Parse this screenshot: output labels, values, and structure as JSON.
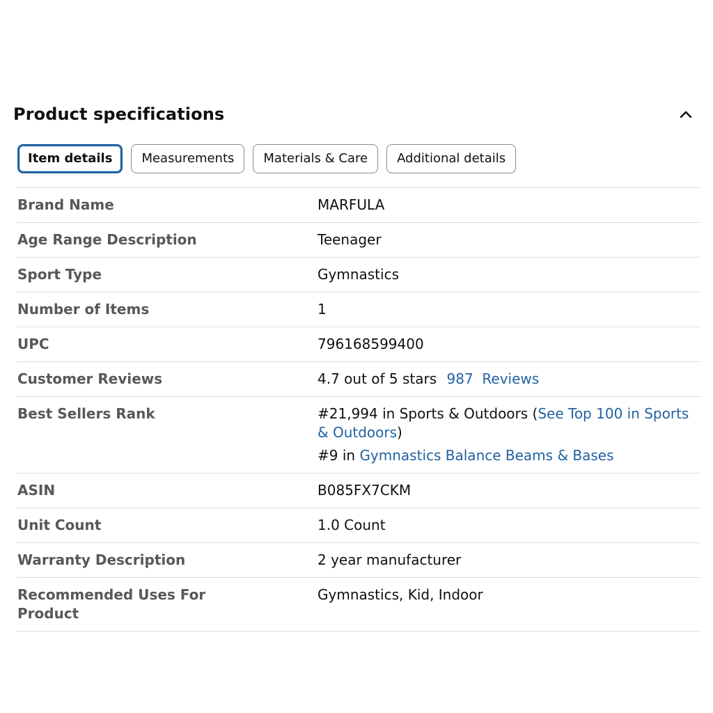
{
  "section": {
    "title": "Product specifications",
    "collapse_icon": "chevron-up-icon"
  },
  "tabs": [
    {
      "label": "Item details",
      "active": true
    },
    {
      "label": "Measurements",
      "active": false
    },
    {
      "label": "Materials & Care",
      "active": false
    },
    {
      "label": "Additional details",
      "active": false
    }
  ],
  "specs": {
    "brand": {
      "label": "Brand Name",
      "value": "MARFULA"
    },
    "age_range": {
      "label": "Age Range Description",
      "value": "Teenager"
    },
    "sport_type": {
      "label": "Sport Type",
      "value": "Gymnastics"
    },
    "number_of_items": {
      "label": "Number of Items",
      "value": "1"
    },
    "upc": {
      "label": "UPC",
      "value": "796168599400"
    },
    "customer_reviews": {
      "label": "Customer Reviews",
      "stars_text": "4.7 out of 5 stars",
      "count": "987",
      "reviews_link": "Reviews"
    },
    "best_sellers_rank": {
      "label": "Best Sellers Rank",
      "rank1_prefix": "#21,994 in Sports & Outdoors (",
      "rank1_link": "See Top 100 in Sports & Outdoors",
      "rank1_suffix": ")",
      "rank2_prefix": "#9 in ",
      "rank2_link": "Gymnastics Balance Beams & Bases"
    },
    "asin": {
      "label": "ASIN",
      "value": "B085FX7CKM"
    },
    "unit_count": {
      "label": "Unit Count",
      "value": "1.0 Count"
    },
    "warranty": {
      "label": "Warranty Description",
      "value": "2 year manufacturer"
    },
    "recommended_uses": {
      "label": "Recommended Uses For Product",
      "value": "Gymnastics, Kid, Indoor"
    }
  },
  "colors": {
    "link": "#2162a1",
    "active_tab_border": "#2162a1",
    "label_text": "#565959",
    "value_text": "#0f1111",
    "divider": "#dddddd"
  }
}
